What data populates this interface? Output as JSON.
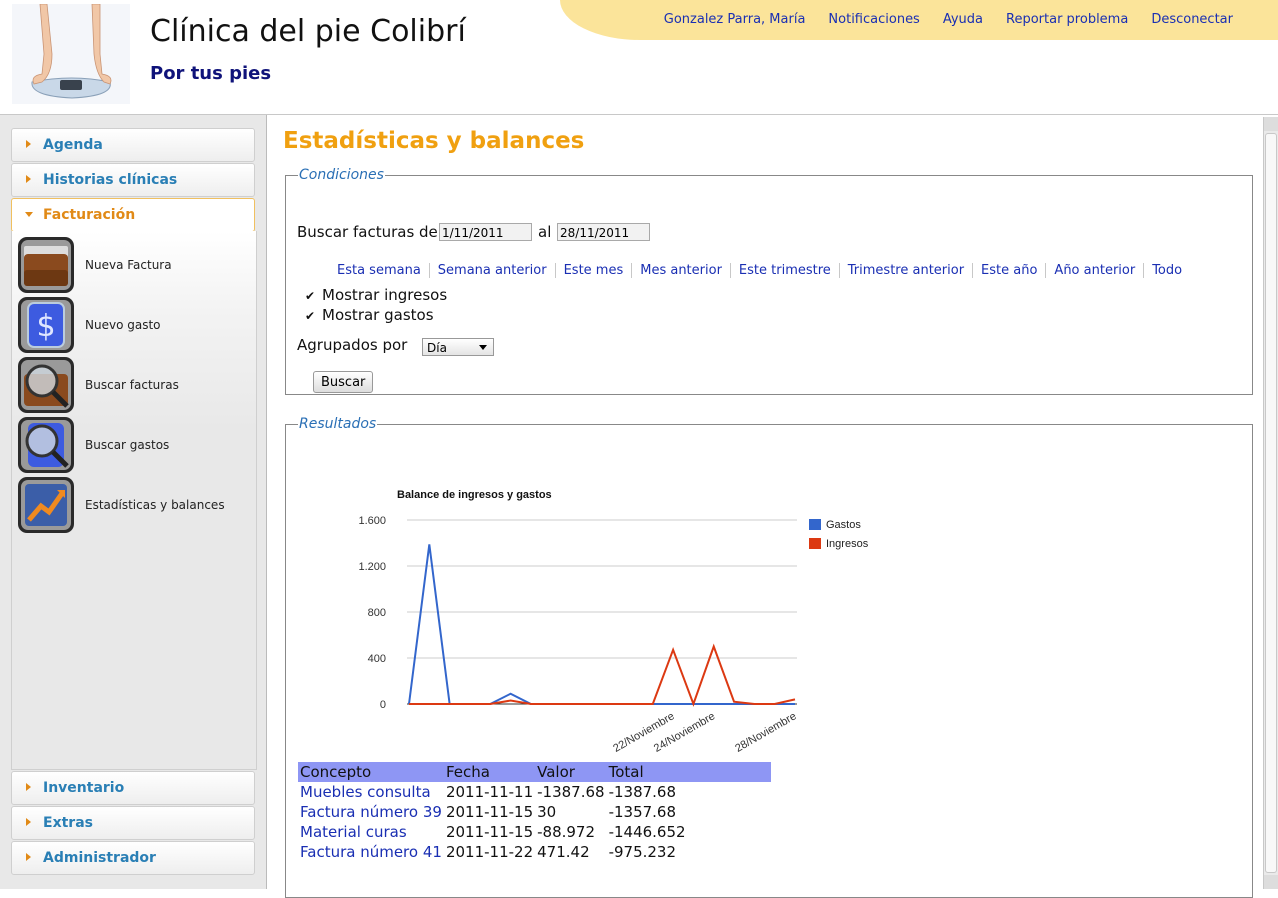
{
  "header": {
    "title": "Clínica del pie Colibrí",
    "subtitle": "Por tus pies",
    "links": [
      "Gonzalez Parra, María",
      "Notificaciones",
      "Ayuda",
      "Reportar problema",
      "Desconectar"
    ]
  },
  "sidebar": {
    "sections_top": [
      "Agenda",
      "Historias clínicas"
    ],
    "active_section": "Facturación",
    "menu_items": [
      "Nueva Factura",
      "Nuevo gasto",
      "Buscar facturas",
      "Buscar gastos",
      "Estadísticas y balances"
    ],
    "sections_bottom": [
      "Inventario",
      "Extras",
      "Administrador"
    ]
  },
  "main": {
    "page_title": "Estadísticas y balances",
    "conditions": {
      "legend": "Condiciones",
      "search_label": "Buscar facturas del",
      "from_date": "1/11/2011",
      "to_label": "al",
      "to_date": "28/11/2011",
      "quick_ranges": [
        "Esta semana",
        "Semana anterior",
        "Este mes",
        "Mes anterior",
        "Este trimestre",
        "Trimestre anterior",
        "Este año",
        "Año anterior",
        "Todo"
      ],
      "show_income_label": "Mostrar ingresos",
      "show_income": true,
      "show_expenses_label": "Mostrar gastos",
      "show_expenses": true,
      "group_label": "Agrupados por",
      "group_value": "Día",
      "search_button": "Buscar"
    },
    "results": {
      "legend": "Resultados",
      "table_headers": [
        "Concepto",
        "Fecha",
        "Valor",
        "Total"
      ],
      "rows": [
        [
          "Muebles consulta",
          "2011-11-11",
          "-1387.68",
          "-1387.68"
        ],
        [
          "Factura número 39",
          "2011-11-15",
          "30",
          "-1357.68"
        ],
        [
          "Material curas",
          "2011-11-15",
          "-88.972",
          "-1446.652"
        ],
        [
          "Factura número 41",
          "2011-11-22",
          "471.42",
          "-975.232"
        ]
      ]
    }
  },
  "chart_data": {
    "type": "line",
    "title": "Balance de ingresos y gastos",
    "ylim": [
      0,
      1600
    ],
    "yticks": [
      "0",
      "400",
      "800",
      "1.200",
      "1.600"
    ],
    "x_tick_labels": [
      "22/Noviembre",
      "24/Noviembre",
      "28/Noviembre"
    ],
    "legend_position": "right",
    "grid": true,
    "series": [
      {
        "name": "Gastos",
        "color": "#3366cc",
        "values": [
          0,
          1388,
          0,
          0,
          0,
          89,
          0,
          0,
          0,
          0,
          0,
          0,
          0,
          0,
          0,
          0,
          0,
          0,
          0,
          0
        ]
      },
      {
        "name": "Ingresos",
        "color": "#dc3912",
        "values": [
          0,
          0,
          0,
          0,
          0,
          30,
          0,
          0,
          0,
          0,
          0,
          0,
          0,
          471,
          0,
          500,
          20,
          0,
          0,
          40
        ]
      }
    ]
  }
}
